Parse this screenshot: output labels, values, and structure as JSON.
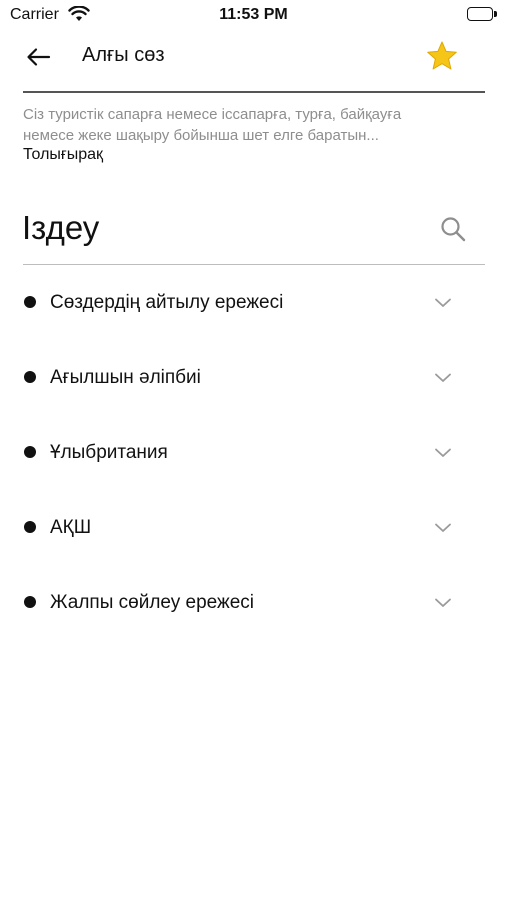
{
  "status_bar": {
    "carrier": "Carrier",
    "time": "11:53 PM"
  },
  "nav": {
    "title": "Алғы сөз"
  },
  "intro": {
    "line1": "Сіз  туристік сапарға немесе іссапарға, турға, байқауға",
    "line2": "немесе жеке шақыру бойынша шет елге баратын...",
    "more": "Толығырақ"
  },
  "search": {
    "title": "Іздеу"
  },
  "sections": [
    {
      "label": "Сөздердің айтылу ережесі"
    },
    {
      "label": "Ағылшын әліпбиі"
    },
    {
      "label": "Ұлыбритания"
    },
    {
      "label": "АҚШ"
    },
    {
      "label": "Жалпы сөйлеу ережесі"
    }
  ],
  "colors": {
    "star": "#F5C518",
    "text": "#111111",
    "muted": "#8E8E8E",
    "divider": "#BDBDBD"
  },
  "icons": {
    "back": "arrow-left-icon",
    "favorite": "star-icon",
    "search": "search-icon",
    "expand": "chevron-down-icon",
    "wifi": "wifi-icon",
    "battery": "battery-icon"
  }
}
